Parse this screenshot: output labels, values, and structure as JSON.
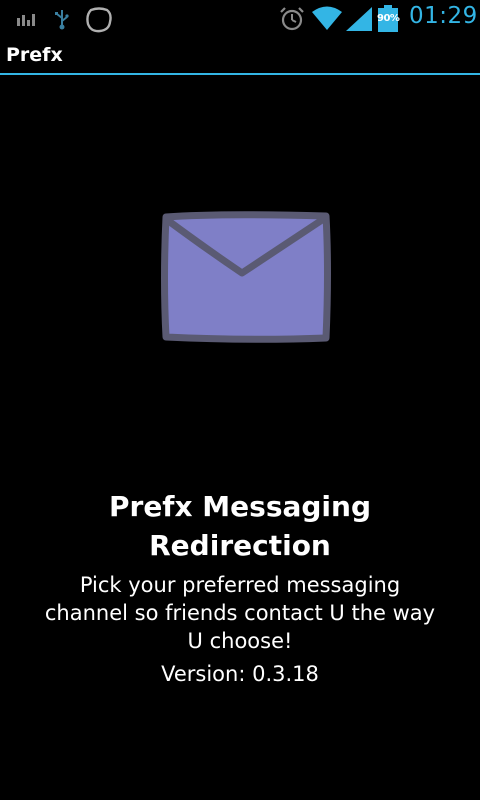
{
  "status_bar": {
    "notification_icons": [
      "chart-icon",
      "usb-icon",
      "app-notification-icon"
    ],
    "system_icons": [
      "alarm-icon",
      "wifi-icon",
      "signal-icon",
      "battery-icon"
    ],
    "battery_percent": "90%",
    "clock": "01:29",
    "accent_color": "#33b5e5"
  },
  "app_bar": {
    "title": "Prefx",
    "divider_color": "#33b5e5"
  },
  "main": {
    "logo_icon": "envelope-icon",
    "logo_color": "#7f7fc7",
    "app_name": "Prefx Messaging Redirection",
    "description": "Pick your preferred messaging channel so friends contact U the way U choose!",
    "version": "Version: 0.3.18"
  }
}
